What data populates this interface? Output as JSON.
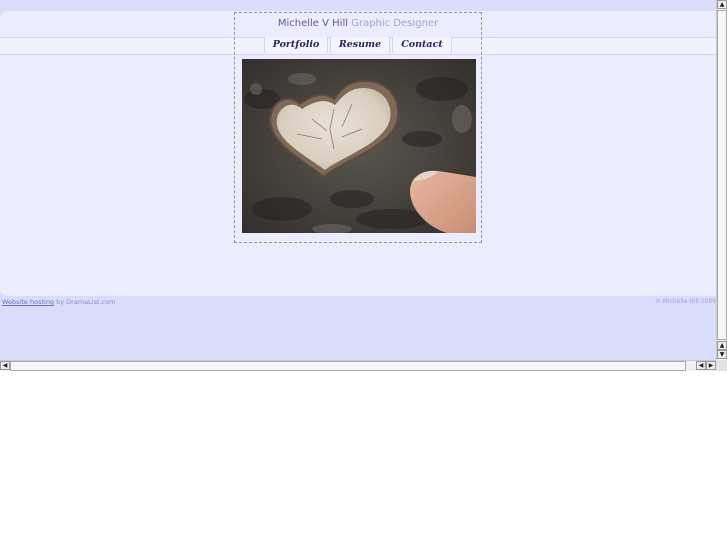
{
  "header": {
    "name": "Michelle V Hill",
    "role": "Graphic Designer"
  },
  "nav": {
    "items": [
      {
        "label": "Portfolio"
      },
      {
        "label": "Resume"
      },
      {
        "label": "Contact"
      }
    ]
  },
  "photo": {
    "icon": "heart-shaped-wood-photo"
  },
  "footer": {
    "link_text": "Website hosting",
    "by_text": " by DramaList.com",
    "copyright": "© Michelle Hill 2009"
  },
  "colors": {
    "background": "#dadcfc",
    "content_band": "#ebecfe",
    "nav_text": "#1f2660",
    "frame_border": "#8d90c9"
  }
}
